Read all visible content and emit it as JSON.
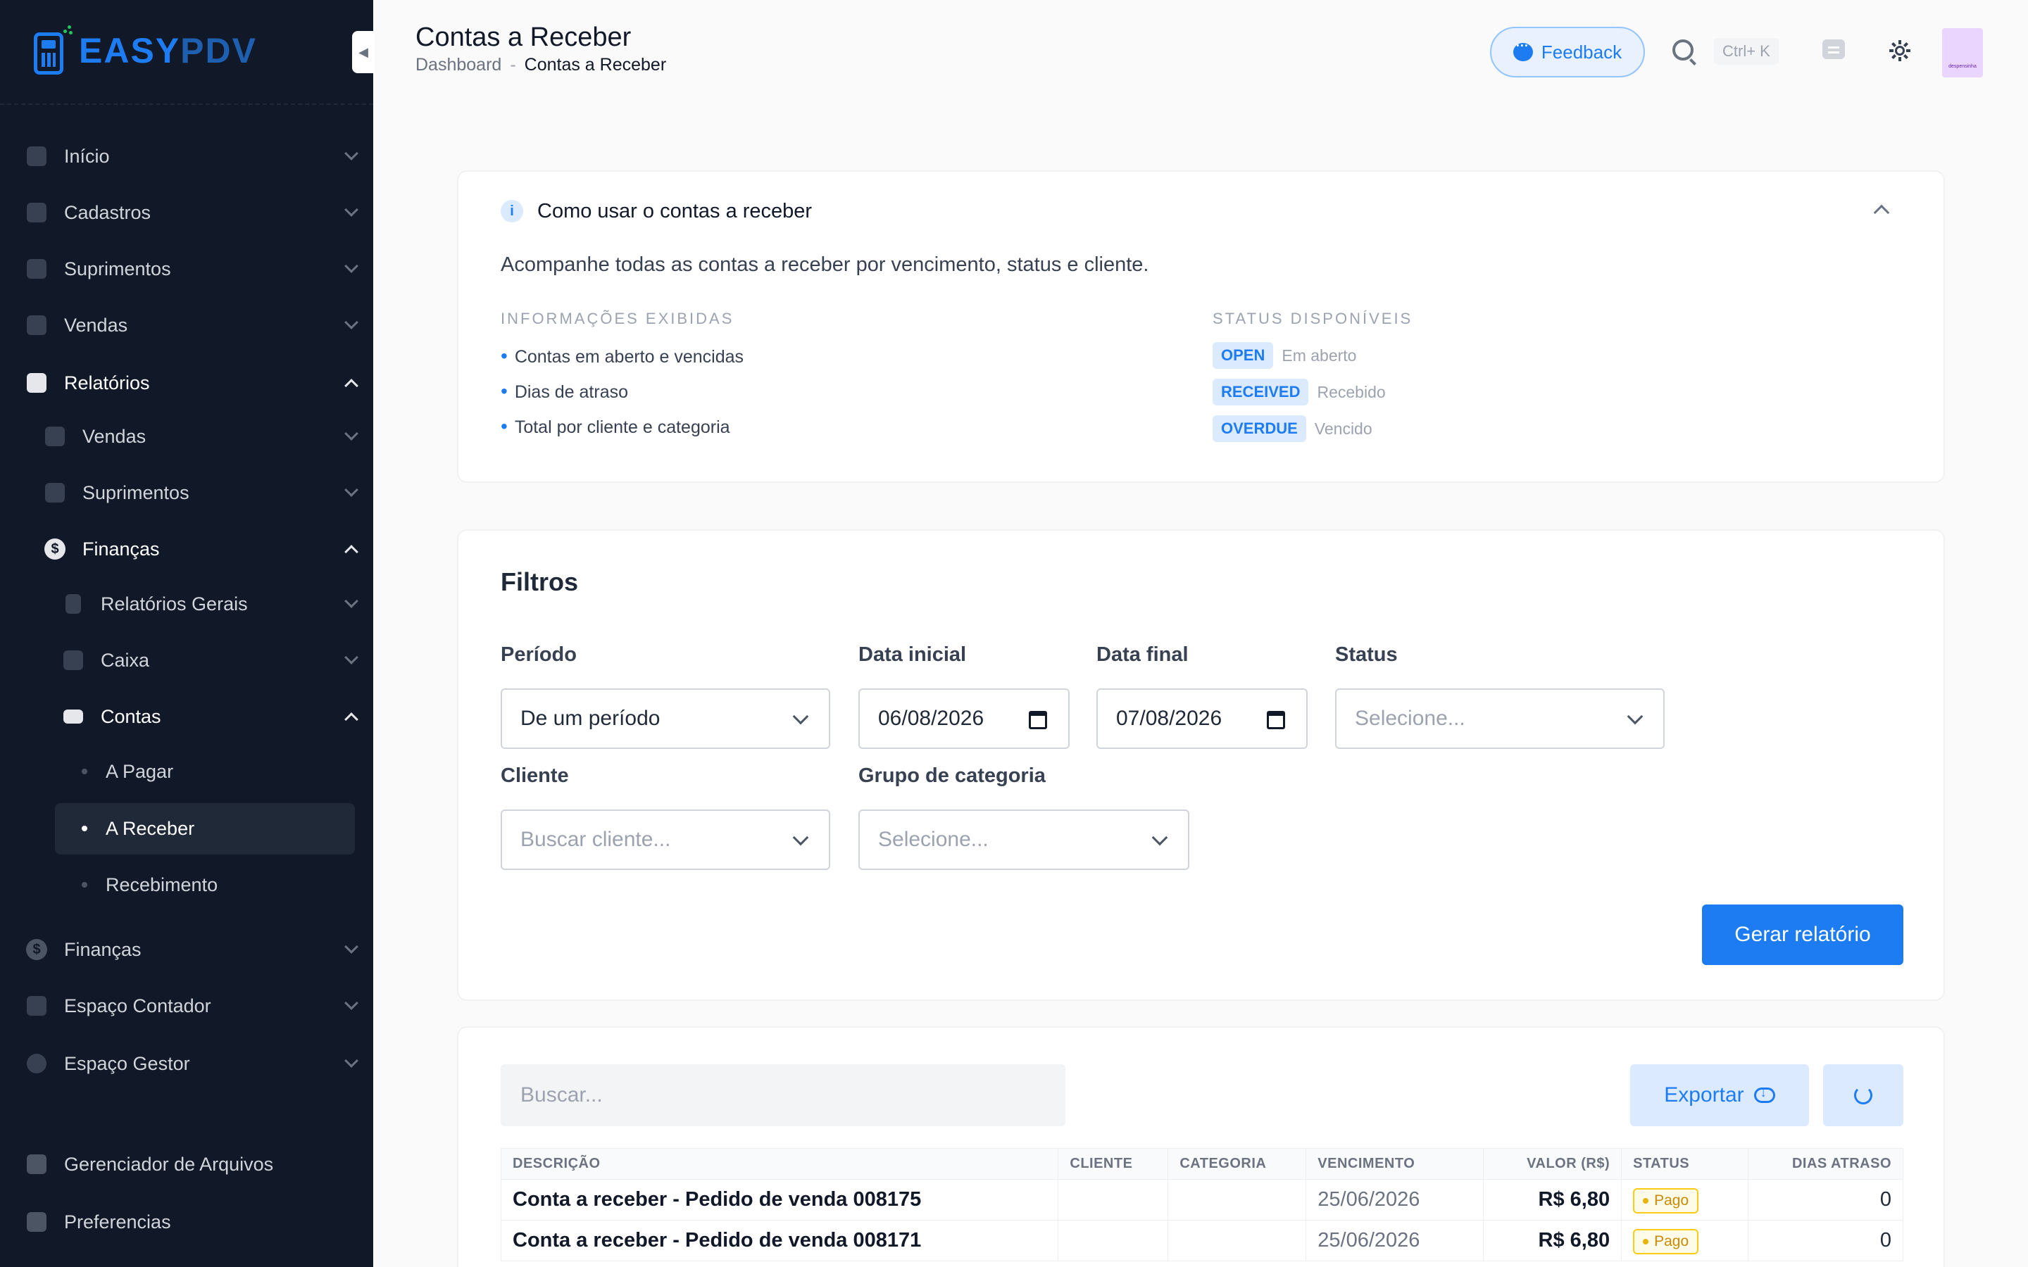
{
  "app": {
    "logo_text": "EASYPDV",
    "logo_primary": "EASY",
    "logo_secondary": "PDV"
  },
  "sidebar": {
    "items": [
      {
        "label": "Início",
        "icon": "grid-icon"
      },
      {
        "label": "Cadastros",
        "icon": "id-card-icon"
      },
      {
        "label": "Suprimentos",
        "icon": "box-icon"
      },
      {
        "label": "Vendas",
        "icon": "register-icon"
      },
      {
        "label": "Relatórios",
        "icon": "chart-icon",
        "expanded": true
      },
      {
        "label": "Vendas",
        "icon": "register-icon"
      },
      {
        "label": "Suprimentos",
        "icon": "box-icon"
      },
      {
        "label": "Finanças",
        "icon": "dollar-icon",
        "expanded": true
      },
      {
        "label": "Relatórios Gerais",
        "icon": "bar-chart-icon"
      },
      {
        "label": "Caixa",
        "icon": "wallet-icon"
      },
      {
        "label": "Contas",
        "icon": "money-icon",
        "expanded": true
      },
      {
        "label": "A Pagar"
      },
      {
        "label": "A Receber",
        "selected": true
      },
      {
        "label": "Recebimento"
      },
      {
        "label": "Finanças",
        "icon": "dollar-icon"
      },
      {
        "label": "Espaço Contador",
        "icon": "calculator-icon"
      },
      {
        "label": "Espaço Gestor",
        "icon": "gear-icon"
      },
      {
        "label": "Gerenciador de Arquivos",
        "icon": "folder-icon"
      },
      {
        "label": "Preferencias",
        "icon": "sliders-icon"
      }
    ]
  },
  "header": {
    "title": "Contas a Receber",
    "breadcrumb": [
      "Dashboard",
      "Contas a Receber"
    ],
    "breadcrumb_sep": "-",
    "feedback_label": "Feedback",
    "shortcut": "Ctrl+ K",
    "avatar_text": "despensinha"
  },
  "info": {
    "title": "Como usar o contas a receber",
    "description": "Acompanhe todas as contas a receber por vencimento, status e cliente.",
    "shown_label": "INFORMAÇÕES EXIBIDAS",
    "shown_items": [
      "Contas em aberto e vencidas",
      "Dias de atraso",
      "Total por cliente e categoria"
    ],
    "status_label": "STATUS DISPONÍVEIS",
    "statuses": [
      {
        "code": "OPEN",
        "desc": "Em aberto"
      },
      {
        "code": "RECEIVED",
        "desc": "Recebido"
      },
      {
        "code": "OVERDUE",
        "desc": "Vencido"
      }
    ]
  },
  "filters": {
    "title": "Filtros",
    "period_label": "Período",
    "period_value": "De um período",
    "start_label": "Data inicial",
    "start_value": "06/08/2026",
    "end_label": "Data final",
    "end_value": "07/08/2026",
    "status_label": "Status",
    "status_placeholder": "Selecione...",
    "client_label": "Cliente",
    "client_placeholder": "Buscar cliente...",
    "category_label": "Grupo de categoria",
    "category_placeholder": "Selecione...",
    "generate_label": "Gerar relatório"
  },
  "table": {
    "search_placeholder": "Buscar...",
    "export_label": "Exportar",
    "columns": [
      "DESCRIÇÃO",
      "CLIENTE",
      "CATEGORIA",
      "VENCIMENTO",
      "VALOR (R$)",
      "STATUS",
      "DIAS ATRASO"
    ],
    "rows": [
      {
        "description": "Conta a receber - Pedido de venda 008175",
        "client": "",
        "category": "",
        "due": "25/06/2026",
        "value": "R$ 6,80",
        "status": "Pago",
        "late_days": "0"
      },
      {
        "description": "Conta a receber - Pedido de venda 008171",
        "client": "",
        "category": "",
        "due": "25/06/2026",
        "value": "R$ 6,80",
        "status": "Pago",
        "late_days": "0"
      }
    ]
  },
  "colors": {
    "accent": "#1d7cf2",
    "sidebar_bg": "#111827",
    "status_paid": "#eab308"
  }
}
